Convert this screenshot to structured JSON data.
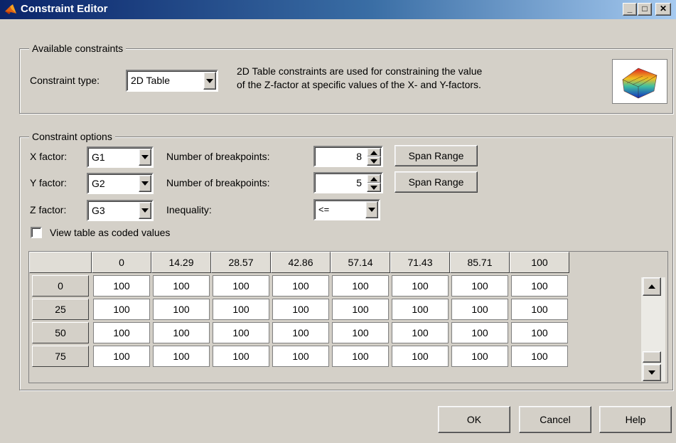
{
  "window": {
    "title": "Constraint Editor",
    "minimize_symbol": "_",
    "maximize_symbol": "□",
    "close_symbol": "✕"
  },
  "available": {
    "legend": "Available constraints",
    "type_label": "Constraint type:",
    "type_value": "2D Table",
    "description_line1": "2D Table constraints are used for constraining the value",
    "description_line2": "of the Z-factor at specific values of the X- and Y-factors.",
    "icon": "surface-plot-icon"
  },
  "options": {
    "legend": "Constraint options",
    "x_factor_label": "X factor:",
    "x_factor_value": "G1",
    "y_factor_label": "Y factor:",
    "y_factor_value": "G2",
    "z_factor_label": "Z factor:",
    "z_factor_value": "G3",
    "x_breakpoints_label": "Number of breakpoints:",
    "x_breakpoints_value": "8",
    "y_breakpoints_label": "Number of breakpoints:",
    "y_breakpoints_value": "5",
    "inequality_label": "Inequality:",
    "inequality_value": "<=",
    "span_range_label": "Span Range",
    "coded_checkbox_label": "View table as coded values",
    "coded_checked": false
  },
  "table": {
    "columns": [
      "0",
      "14.29",
      "28.57",
      "42.86",
      "57.14",
      "71.43",
      "85.71",
      "100"
    ],
    "rows": [
      {
        "label": "0",
        "values": [
          "100",
          "100",
          "100",
          "100",
          "100",
          "100",
          "100",
          "100"
        ]
      },
      {
        "label": "25",
        "values": [
          "100",
          "100",
          "100",
          "100",
          "100",
          "100",
          "100",
          "100"
        ]
      },
      {
        "label": "50",
        "values": [
          "100",
          "100",
          "100",
          "100",
          "100",
          "100",
          "100",
          "100"
        ]
      },
      {
        "label": "75",
        "values": [
          "100",
          "100",
          "100",
          "100",
          "100",
          "100",
          "100",
          "100"
        ]
      }
    ]
  },
  "buttons": {
    "ok": "OK",
    "cancel": "Cancel",
    "help": "Help"
  }
}
